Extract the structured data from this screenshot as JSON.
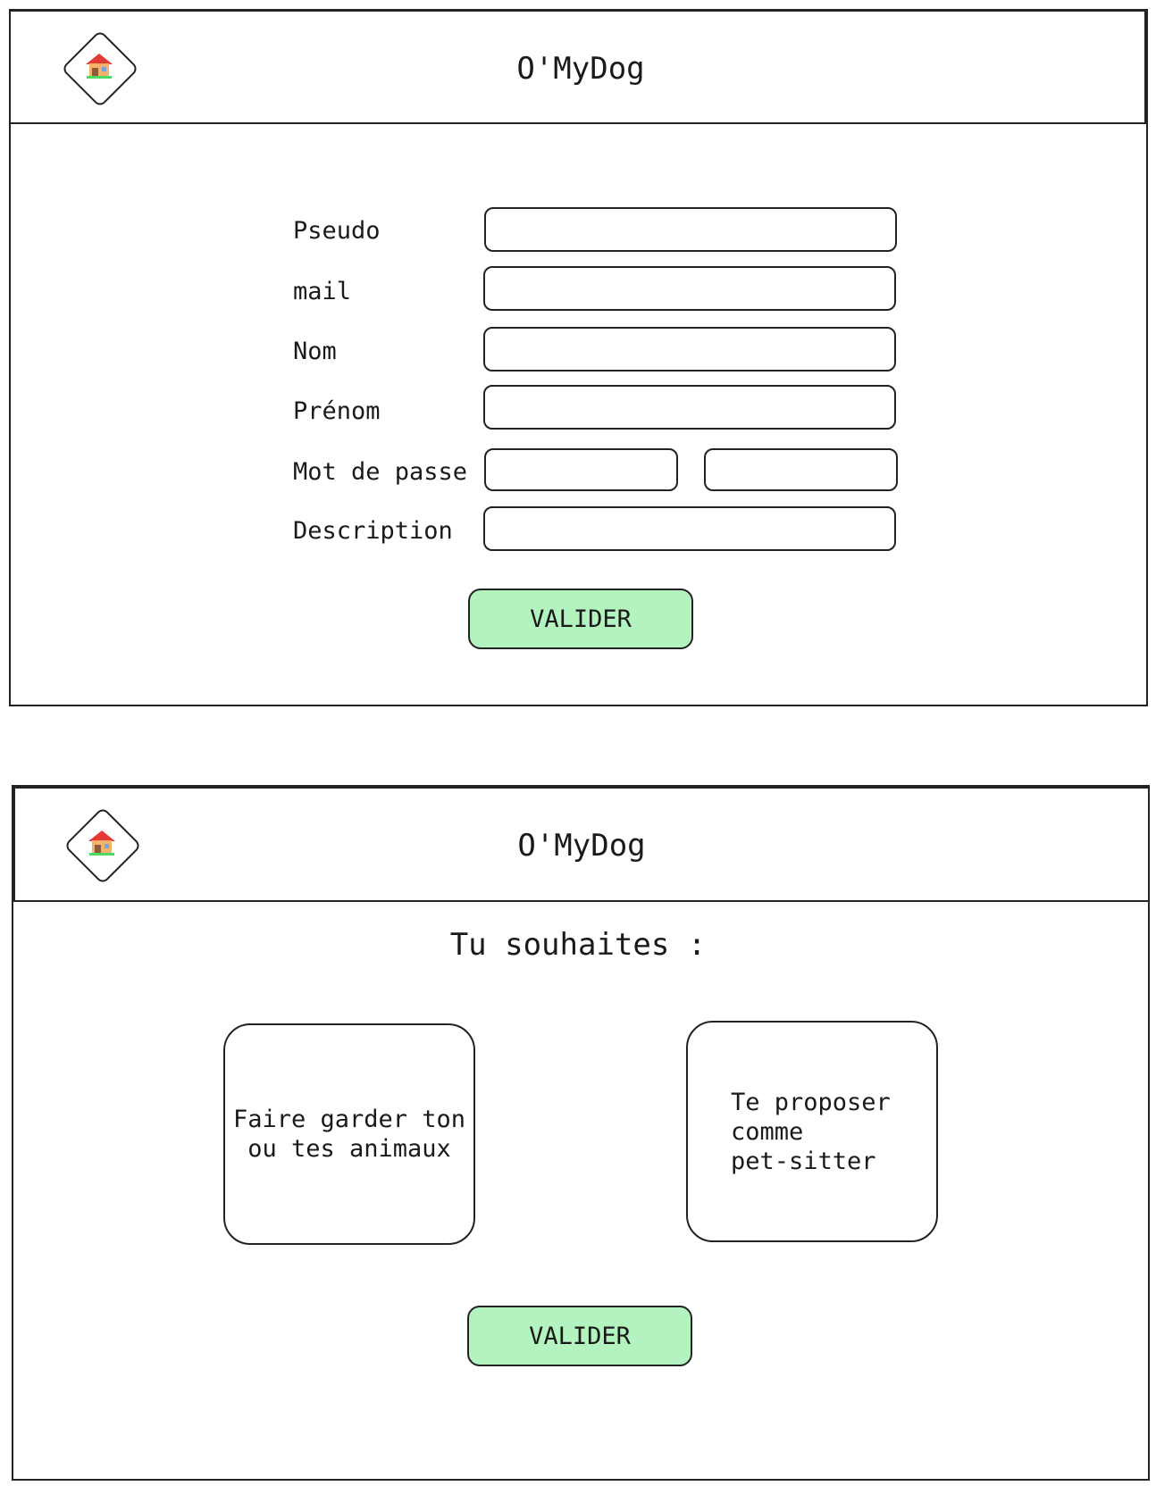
{
  "screens": [
    {
      "header": {
        "title": "O'MyDog",
        "home_icon": "house-icon"
      },
      "form": {
        "pseudo_label": "Pseudo",
        "mail_label": "mail",
        "nom_label": "Nom",
        "prenom_label": "Prénom",
        "password_label": "Mot de passe",
        "description_label": "Description",
        "pseudo_value": "",
        "mail_value": "",
        "nom_value": "",
        "prenom_value": "",
        "password_value": "",
        "password_confirm_value": "",
        "description_value": ""
      },
      "submit_label": "VALIDER"
    },
    {
      "header": {
        "title": "O'MyDog",
        "home_icon": "house-icon"
      },
      "question": "Tu souhaites :",
      "choices": [
        {
          "label": "Faire garder ton\nou tes animaux"
        },
        {
          "label": "Te proposer\ncomme\npet-sitter"
        }
      ],
      "submit_label": "VALIDER"
    }
  ],
  "colors": {
    "button_fill": "#b3f3bf",
    "border": "#222222",
    "house_roof": "#e53935",
    "house_wall": "#f6b26b",
    "house_door": "#8d5a3b",
    "house_window": "#6fa8dc",
    "house_grass": "#4cd964"
  }
}
